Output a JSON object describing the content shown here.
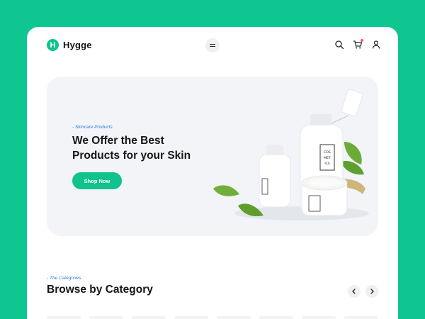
{
  "brand": {
    "name": "Hygge",
    "mark": "H"
  },
  "header": {
    "icons": [
      "menu-icon",
      "search-icon",
      "cart-icon",
      "user-icon"
    ]
  },
  "hero": {
    "eyebrow": "- Skincare Products",
    "title": "We Offer the Best Products for your Skin",
    "cta_label": "Shop Now",
    "bottle_label": "COS MET ICS"
  },
  "categories": {
    "eyebrow": "- The Categories",
    "title": "Browse by Category",
    "prev_icon": "chevron-left-icon",
    "next_icon": "chevron-right-icon"
  },
  "colors": {
    "accent": "#10c28d",
    "background": "#0fc690",
    "eyebrow": "#2f7bd6",
    "hero_bg": "#f2f4f8"
  }
}
